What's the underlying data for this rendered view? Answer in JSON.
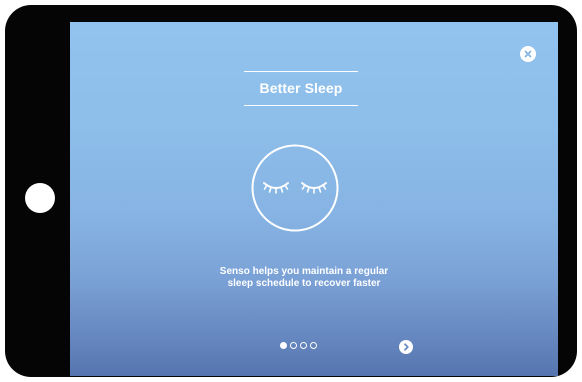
{
  "onboarding": {
    "title": "Better Sleep",
    "message_line1": "Senso helps you maintain a regular",
    "message_line2": "sleep schedule to recover faster",
    "page_count": 4,
    "current_page": 1
  },
  "icons": {
    "close": "close-icon",
    "next": "chevron-right-icon",
    "illustration": "sleeping-eyes-icon"
  },
  "colors": {
    "background_top": "#92c3ee",
    "background_bottom": "#5675b0",
    "foreground": "#ffffff",
    "device_frame": "#050505"
  }
}
